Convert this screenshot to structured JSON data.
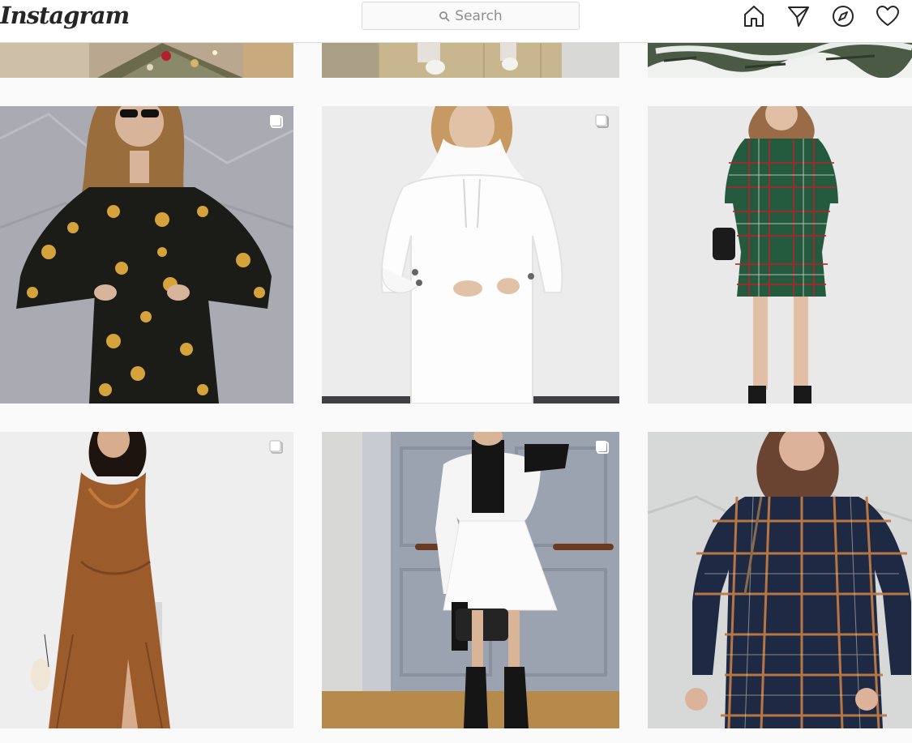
{
  "header": {
    "logo": "Instagram",
    "search_placeholder": "Search",
    "nav": [
      {
        "icon": "home-icon"
      },
      {
        "icon": "direct-message-icon"
      },
      {
        "icon": "explore-icon"
      },
      {
        "icon": "activity-heart-icon"
      }
    ]
  },
  "grid": {
    "rows": [
      {
        "posts": [
          {
            "subject": "christmas tree branches with ornaments",
            "multi": false
          },
          {
            "subject": "white sneakers on tiled floor",
            "multi": false
          },
          {
            "subject": "snow-covered pine branches",
            "multi": false
          }
        ]
      },
      {
        "posts": [
          {
            "subject": "black floral print long sleeve dress",
            "multi": true
          },
          {
            "subject": "white hoodie sweatshirt dress",
            "multi": true
          },
          {
            "subject": "green and red plaid shirt dress",
            "multi": false
          }
        ]
      },
      {
        "posts": [
          {
            "subject": "brown satin slip maxi dress",
            "multi": true
          },
          {
            "subject": "black and white colorblock dress",
            "multi": true
          },
          {
            "subject": "navy plaid button front dress",
            "multi": false
          }
        ]
      }
    ]
  },
  "colors": {
    "header_bg": "#ffffff",
    "page_bg": "#fafafa",
    "border": "#dbdbdb",
    "icon": "#262626"
  }
}
